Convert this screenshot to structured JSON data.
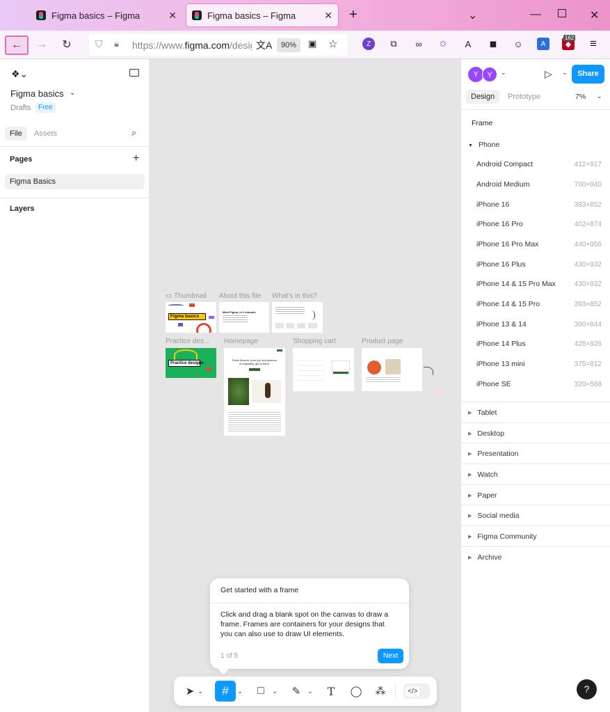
{
  "browser": {
    "tabs": [
      {
        "title": "Figma basics – Figma"
      },
      {
        "title": "Figma basics – Figma"
      }
    ],
    "url_prefix": "https://www.",
    "url_domain": "figma.com",
    "url_rest": "/design",
    "zoom": "90%",
    "ext_badge": "162",
    "ext_avatar": "Z"
  },
  "left": {
    "file_name": "Figma basics",
    "drafts": "Drafts",
    "plan": "Free",
    "tab_file": "File",
    "tab_assets": "Assets",
    "pages_title": "Pages",
    "page_item": "Figma Basics",
    "layers_title": "Layers"
  },
  "right": {
    "avatar1": "Y",
    "avatar2": "Y",
    "share": "Share",
    "tab_design": "Design",
    "tab_prototype": "Prototype",
    "zoom": "7%",
    "frame_title": "Frame",
    "phone_group": "Phone",
    "presets": [
      {
        "name": "Android Compact",
        "size": "412×917"
      },
      {
        "name": "Android Medium",
        "size": "700×840"
      },
      {
        "name": "iPhone 16",
        "size": "393×852"
      },
      {
        "name": "iPhone 16 Pro",
        "size": "402×874"
      },
      {
        "name": "iPhone 16 Pro Max",
        "size": "440×956"
      },
      {
        "name": "iPhone 16 Plus",
        "size": "430×932"
      },
      {
        "name": "iPhone 14 & 15 Pro Max",
        "size": "430×932"
      },
      {
        "name": "iPhone 14 & 15 Pro",
        "size": "393×852"
      },
      {
        "name": "iPhone 13 & 14",
        "size": "390×844"
      },
      {
        "name": "iPhone 14 Plus",
        "size": "428×926"
      },
      {
        "name": "iPhone 13 mini",
        "size": "375×812"
      },
      {
        "name": "iPhone SE",
        "size": "320×568"
      }
    ],
    "groups": [
      "Tablet",
      "Desktop",
      "Presentation",
      "Watch",
      "Paper",
      "Social media",
      "Figma Community",
      "Archive"
    ]
  },
  "canvas": {
    "frames": {
      "thumbnail": "Thumbnail",
      "about": "About this file",
      "whats_in": "What's in this?",
      "practice": "Practice des...",
      "homepage": "Homepage",
      "cart": "Shopping cart",
      "product": "Product page"
    },
    "thumb_badge": "Figma basics",
    "about_heading": "Meet Figma, in 2 minutes",
    "practice_badge": "Practice designs",
    "home_heading": "Fresh flowers, pure joy, and pictures of originality, get in there."
  },
  "tooltip": {
    "title": "Get started with a frame",
    "body": "Click and drag a blank spot on the canvas to draw a frame. Frames are containers for your designs that you can also use to draw UI elements.",
    "step": "1 of 5",
    "next": "Next"
  },
  "help": "?",
  "colors": {
    "accent": "#0d99ff",
    "purple": "#9747ff",
    "green": "#1bb05a"
  }
}
